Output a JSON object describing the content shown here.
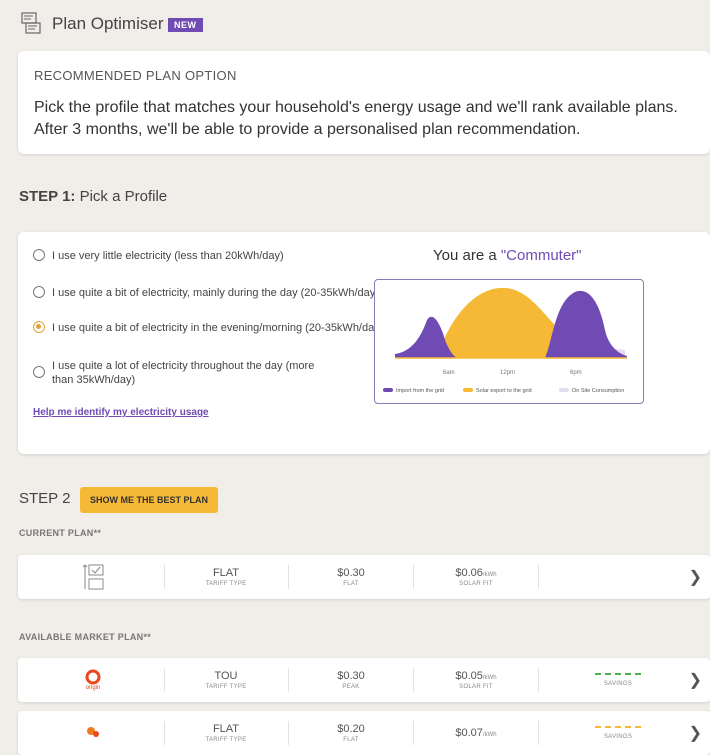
{
  "header": {
    "title": "Plan Optimiser",
    "badge": "NEW"
  },
  "recommended": {
    "heading": "RECOMMENDED PLAN OPTION",
    "body": "Pick the profile that matches your household's energy usage and we'll rank available plans. After 3 months, we'll be able to provide a personalised plan recommendation."
  },
  "step1": {
    "label_bold": "STEP 1:",
    "label_text": " Pick a Profile",
    "options": [
      {
        "label": "I use very little electricity (less than 20kWh/day)",
        "selected": false
      },
      {
        "label": "I use quite a bit of electricity, mainly during the day (20-35kWh/day)",
        "selected": false
      },
      {
        "label": "I use quite a bit of electricity in the evening/morning (20-35kWh/day)",
        "selected": true
      },
      {
        "label": "I use quite a lot of electricity throughout the day (more than 35kWh/day)",
        "selected": false
      }
    ],
    "help_link": "Help me identify my electricity usage",
    "you_are_prefix": "You are a ",
    "profile_name": "\"Commuter\""
  },
  "usage_chart": {
    "ticks": [
      "6am",
      "12pm",
      "6pm"
    ],
    "legend": [
      {
        "label": "Import from the grid",
        "color": "#6f4bb3"
      },
      {
        "label": "Solar export to the grid",
        "color": "#f5b936"
      },
      {
        "label": "On Site Consumption",
        "color": "#e4dcf0"
      }
    ]
  },
  "step2": {
    "label": "STEP 2",
    "button": "SHOW ME THE BEST PLAN",
    "current_label": "CURRENT PLAN**",
    "available_label": "AVAILABLE MARKET PLAN**"
  },
  "current_plan": {
    "icon": "tariff-doc-icon",
    "tariff": "FLAT",
    "tariff_sub": "TARIFF TYPE",
    "rate": "$0.30",
    "rate_sub": "FLAT",
    "fit": "$0.06",
    "fit_unit": "/kWh",
    "fit_sub": "SOLAR FIT"
  },
  "market_plans": [
    {
      "retailer": "origin",
      "logo_color": "#e8491d",
      "tariff": "TOU",
      "tariff_sub": "TARIFF TYPE",
      "rate": "$0.30",
      "rate_sub": "PEAK",
      "fit": "$0.05",
      "fit_unit": "/kWh",
      "fit_sub": "SOLAR FIT",
      "savings_label": "SAVINGS",
      "savings_color": "#4caf50"
    },
    {
      "retailer": "",
      "logo_color": "#f07a1a",
      "tariff": "FLAT",
      "tariff_sub": "TARIFF TYPE",
      "rate": "$0.20",
      "rate_sub": "FLAT",
      "fit": "$0.07",
      "fit_unit": "/kWh",
      "fit_sub": "",
      "savings_label": "SAVINGS",
      "savings_color": "#f5b936"
    }
  ]
}
